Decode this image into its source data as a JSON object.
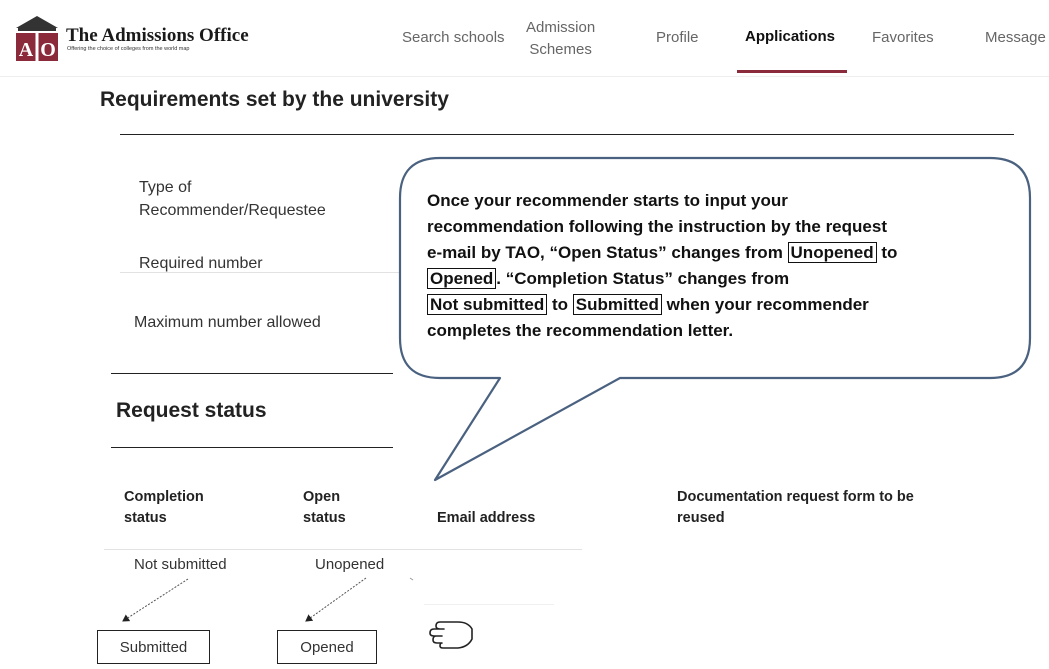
{
  "header": {
    "brand_mark": "AO",
    "brand_title": "The Admissions Office",
    "brand_tagline": "Offering the choice of colleges from the world map",
    "nav": {
      "search_schools": "Search schools",
      "admission_schemes_line1": "Admission",
      "admission_schemes_line2": "Schemes",
      "profile": "Profile",
      "applications": "Applications",
      "favorites": "Favorites",
      "messages": "Message"
    },
    "active_nav": "applications",
    "accent_color": "#8b2a3a"
  },
  "requirements": {
    "heading": "Requirements set by the university",
    "type_of_recommender_line1": "Type of",
    "type_of_recommender_line2": "Recommender/Requestee",
    "required_number": "Required number",
    "maximum_number": "Maximum number allowed"
  },
  "request_status": {
    "heading": "Request status",
    "columns": {
      "completion_line1": "Completion",
      "completion_line2": "status",
      "open_line1": "Open",
      "open_line2": "status",
      "email": "Email address",
      "doc_line1": "Documentation request form to be",
      "doc_line2": "reused"
    },
    "row": {
      "completion": "Not submitted",
      "open": "Unopened"
    },
    "after": {
      "completion": "Submitted",
      "open": "Opened"
    },
    "pointer_icon": "hand-pointer-icon"
  },
  "callout": {
    "l1": "Once your recommender starts to input your",
    "l2": "recommendation following the instruction by the request",
    "l3_pre": "e-mail by TAO, “Open Status” changes from ",
    "l3_box": "Unopened",
    "l3_post": " to",
    "l4_box": "Opened",
    "l4_post": ". “Completion Status” changes from",
    "l5_box1": "Not submitted",
    "l5_mid": " to ",
    "l5_box2": "Submitted",
    "l5_post": " when your recommender",
    "l6": "completes the recommendation letter."
  }
}
